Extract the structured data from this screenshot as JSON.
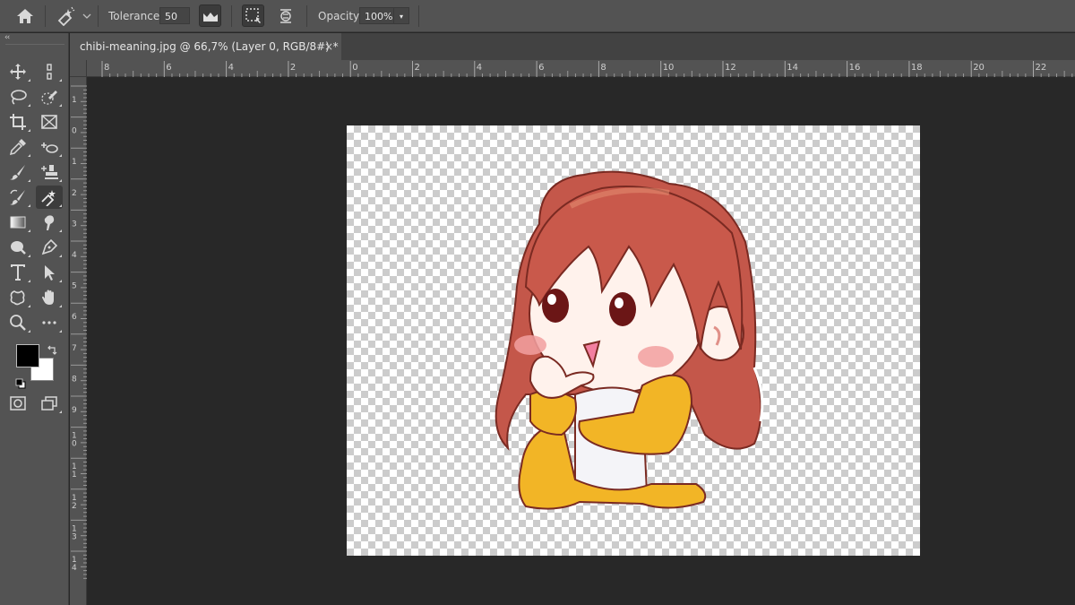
{
  "options_bar": {
    "tolerance_label": "Tolerance:",
    "tolerance_value": "50",
    "opacity_label": "Opacity:",
    "opacity_value": "100%"
  },
  "tools": [
    {
      "name": "move-tool",
      "icon": "move-icon"
    },
    {
      "name": "artboard-tool",
      "icon": "artboard-icon"
    },
    {
      "name": "lasso-tool",
      "icon": "lasso-icon"
    },
    {
      "name": "quick-selection-tool",
      "icon": "quick-selection-icon"
    },
    {
      "name": "crop-tool",
      "icon": "crop-icon"
    },
    {
      "name": "frame-tool",
      "icon": "frame-icon"
    },
    {
      "name": "eyedropper-tool",
      "icon": "eyedropper-icon"
    },
    {
      "name": "spot-healing-tool",
      "icon": "spot-healing-icon"
    },
    {
      "name": "brush-tool",
      "icon": "brush-icon"
    },
    {
      "name": "clone-stamp-tool",
      "icon": "stamp-icon"
    },
    {
      "name": "history-brush-tool",
      "icon": "history-brush-icon"
    },
    {
      "name": "magic-eraser-tool",
      "icon": "magic-eraser-icon"
    },
    {
      "name": "gradient-tool",
      "icon": "gradient-icon"
    },
    {
      "name": "smudge-tool",
      "icon": "smudge-icon"
    },
    {
      "name": "dodge-tool",
      "icon": "dodge-icon"
    },
    {
      "name": "pen-tool",
      "icon": "pen-icon"
    },
    {
      "name": "type-tool",
      "icon": "type-icon"
    },
    {
      "name": "path-selection-tool",
      "icon": "path-selection-icon"
    },
    {
      "name": "custom-shape-tool",
      "icon": "custom-shape-icon"
    },
    {
      "name": "hand-tool",
      "icon": "hand-icon"
    },
    {
      "name": "zoom-tool",
      "icon": "zoom-icon"
    },
    {
      "name": "more-tools",
      "icon": "more-icon"
    }
  ],
  "colors": {
    "foreground": "#000000",
    "background": "#ffffff",
    "panel": "#535353",
    "workspace": "#282828"
  },
  "document": {
    "tab_title": "chibi-meaning.jpg @ 66,7% (Layer 0, RGB/8#) *",
    "close_glyph": "×",
    "image_subject": "chibi-girl-illustration"
  },
  "rulers": {
    "top_labels": [
      "8",
      "6",
      "4",
      "2",
      "0",
      "2",
      "4",
      "6",
      "8",
      "10",
      "12",
      "14",
      "16",
      "18",
      "20",
      "22"
    ],
    "left_labels": [
      "1",
      "0",
      "1",
      "2",
      "3",
      "4",
      "5",
      "6",
      "7",
      "8",
      "9",
      "1\n0",
      "1\n1",
      "1\n2",
      "1\n3",
      "1\n4"
    ]
  }
}
